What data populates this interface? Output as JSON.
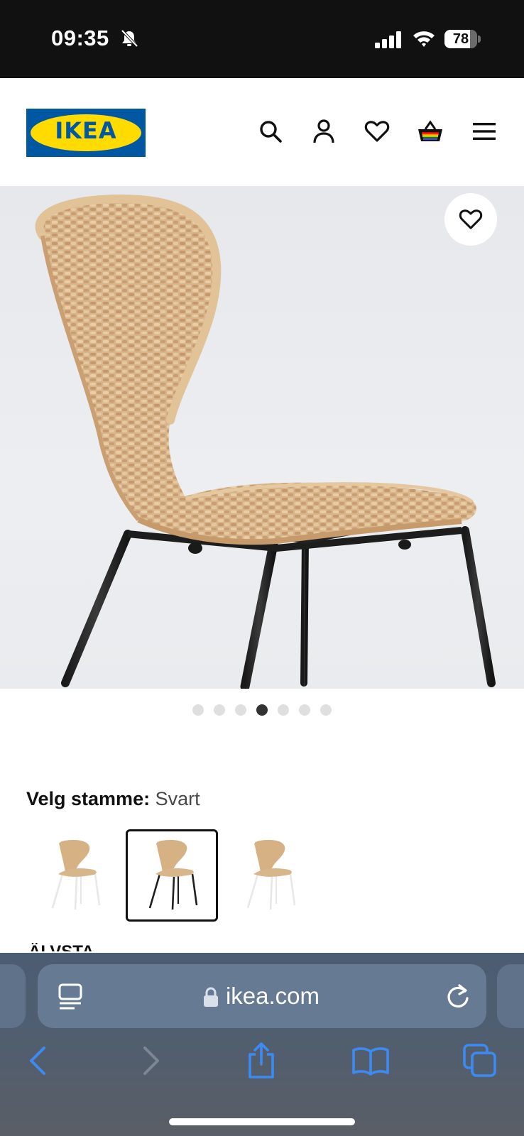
{
  "status_bar": {
    "time": "09:35",
    "battery": "78",
    "battery_level": 0.78
  },
  "header": {
    "logo_text": "IKEA",
    "icons": [
      "search-icon",
      "user-icon",
      "heart-icon",
      "basket-icon",
      "menu-icon"
    ]
  },
  "product": {
    "favorite_icon": "heart-icon",
    "carousel": {
      "total": 7,
      "active_index": 3
    }
  },
  "variant": {
    "label": "Velg stamme:",
    "value": "Svart",
    "options": [
      {
        "leg_color": "#e8e8e8",
        "selected": false
      },
      {
        "leg_color": "#1f1f1f",
        "selected": true
      },
      {
        "leg_color": "#e8e8e8",
        "selected": false
      }
    ]
  },
  "next_section": {
    "heading": "ÄLVSTA"
  },
  "browser": {
    "url": "ikea.com",
    "icons": [
      "reader-icon",
      "lock-icon",
      "reload-icon",
      "back-icon",
      "forward-icon",
      "share-icon",
      "bookmarks-icon",
      "tabs-icon"
    ]
  },
  "colors": {
    "ikea_blue": "#0058a3",
    "ikea_yellow": "#ffdb00",
    "safari_accent": "#3d8bf2"
  }
}
